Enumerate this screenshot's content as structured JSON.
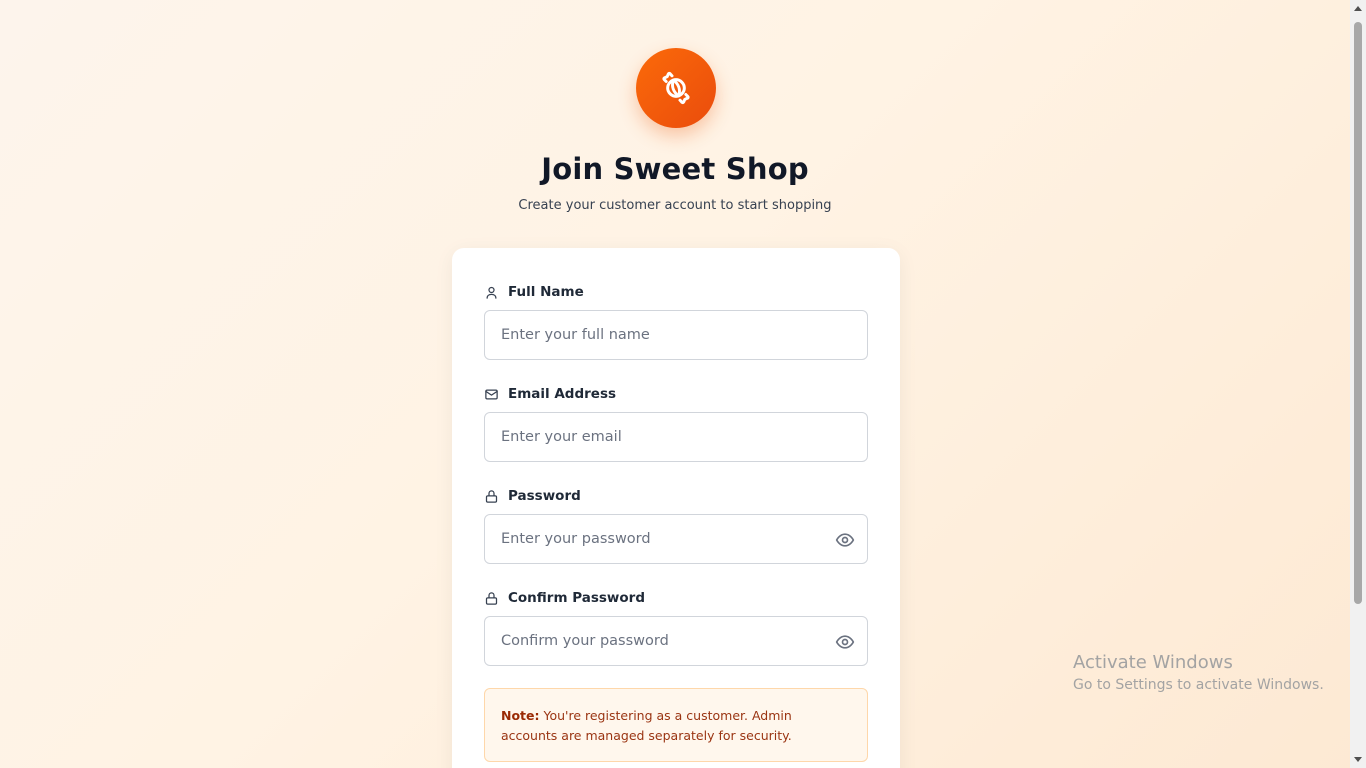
{
  "header": {
    "title": "Join Sweet Shop",
    "subtitle": "Create your customer account to start shopping",
    "logo_icon": "candy-icon"
  },
  "form": {
    "full_name": {
      "label": "Full Name",
      "placeholder": "Enter your full name",
      "icon": "user-icon"
    },
    "email": {
      "label": "Email Address",
      "placeholder": "Enter your email",
      "icon": "mail-icon"
    },
    "password": {
      "label": "Password",
      "placeholder": "Enter your password",
      "icon": "lock-icon"
    },
    "confirm_password": {
      "label": "Confirm Password",
      "placeholder": "Confirm your password",
      "icon": "lock-icon"
    }
  },
  "note": {
    "prefix": "Note:",
    "text": " You're registering as a customer. Admin accounts are managed separately for security."
  },
  "watermark": {
    "line1": "Activate Windows",
    "line2": "Go to Settings to activate Windows."
  },
  "colors": {
    "accent": "#ea580c",
    "note_bg": "#fff7ed",
    "note_text": "#9a3412"
  }
}
